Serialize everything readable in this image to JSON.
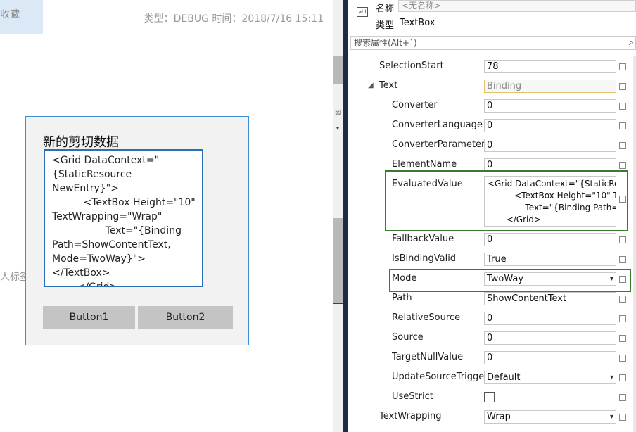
{
  "designer": {
    "favorites_tab": "收藏",
    "meta_text": "类型：DEBUG 时间：2018/7/16 15:11",
    "side_label": "人标签",
    "clip_title": "新的剪切数据",
    "clip_content": "<Grid DataContext=\"{StaticResource NewEntry}\">\n          <TextBox Height=\"10\" TextWrapping=\"Wrap\"\n                 Text=\"{Binding Path=ShowContentText, Mode=TwoWay}\"></TextBox>\n        </Grid>",
    "button1_label": "Button1",
    "button2_label": "Button2"
  },
  "properties": {
    "name_label": "名称",
    "name_placeholder": "<无名称>",
    "type_label": "类型",
    "type_value": "TextBox",
    "type_icon": "textbox-icon",
    "search_placeholder": "搜索属性(Alt+`)",
    "rows": {
      "selection_start": {
        "name": "SelectionStart",
        "value": "78"
      },
      "text": {
        "name": "Text",
        "value": "Binding"
      },
      "converter": {
        "name": "Converter",
        "value": "0"
      },
      "converter_language": {
        "name": "ConverterLanguage",
        "value": "0"
      },
      "converter_parameter": {
        "name": "ConverterParameter",
        "value": "0"
      },
      "element_name": {
        "name": "ElementName",
        "value": "0"
      },
      "evaluated_value": {
        "name": "EvaluatedValue",
        "value": "<Grid DataContext=\"{StaticResource NewEntry}\">\n          <TextBox Height=\"10\" TextWrapping=\"Wrap\"\n              Text=\"{Binding Path=ShowContentText, Mode=TwoWay}\"\n       </Grid>"
      },
      "fallback_value": {
        "name": "FallbackValue",
        "value": "0"
      },
      "is_binding_valid": {
        "name": "IsBindingValid",
        "value": "True"
      },
      "mode": {
        "name": "Mode",
        "value": "TwoWay"
      },
      "path": {
        "name": "Path",
        "value": "ShowContentText"
      },
      "relative_source": {
        "name": "RelativeSource",
        "value": "0"
      },
      "source": {
        "name": "Source",
        "value": "0"
      },
      "target_null_value": {
        "name": "TargetNullValue",
        "value": "0"
      },
      "update_source_trigger": {
        "name": "UpdateSourceTrigger",
        "value": "Default"
      },
      "use_strict": {
        "name": "UseStrict"
      },
      "text_wrapping": {
        "name": "TextWrapping",
        "value": "Wrap"
      }
    }
  },
  "colors": {
    "highlight_border": "#3a7a2e",
    "binding_border": "#e6c36b",
    "window_border": "#3b8fd4"
  }
}
